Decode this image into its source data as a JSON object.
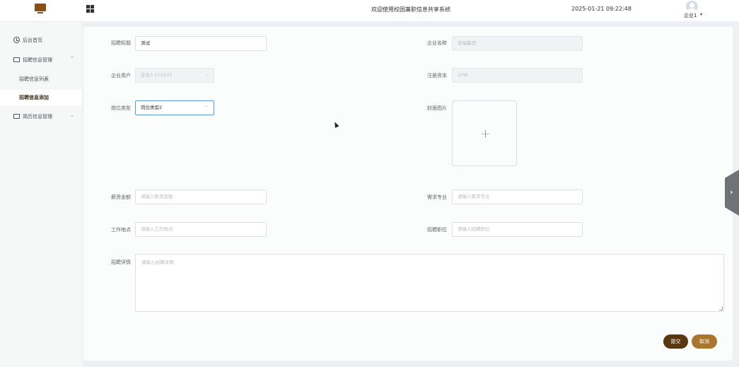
{
  "header": {
    "title": "欢迎使用校园兼职信息共享系统",
    "datetime": "2025-01-21 09:22:48",
    "user": "企业1",
    "user_caret": "▾",
    "logo_icon": "monitor-icon",
    "apps_icon": "grid-icon"
  },
  "sidebar": {
    "items": [
      {
        "label": "后台首页",
        "icon": "clock-icon"
      },
      {
        "label": "招聘信息管理",
        "icon": "box-icon",
        "expanded": true,
        "chevron": "^"
      },
      {
        "label": "招聘信息列表"
      },
      {
        "label": "招聘信息添加",
        "active": true
      },
      {
        "label": "简历信息管理",
        "icon": "box-icon",
        "expanded": false,
        "chevron": "⌄"
      }
    ]
  },
  "form": {
    "title_label": "招聘标题",
    "title_value": "测试",
    "company_label": "企业名称",
    "company_value": "幸福集团",
    "account_label": "企业用户",
    "account_value": "企业1-112233",
    "capital_label": "注册资本",
    "capital_value": "20W",
    "jobtype_label": "岗位类型",
    "jobtype_value": "岗位类型2",
    "cover_label": "封面图片",
    "cover_plus": "+",
    "salary_label": "薪资金额",
    "salary_placeholder": "请输入薪资金额",
    "major_label": "需求专业",
    "major_placeholder": "请输入需求专业",
    "location_label": "工作地点",
    "location_placeholder": "请输入工作地点",
    "position_label": "招聘职位",
    "position_placeholder": "请输入招聘职位",
    "detail_label": "招聘详情",
    "detail_placeholder": "请输入招聘详情"
  },
  "buttons": {
    "submit": "提交",
    "cancel": "取消"
  },
  "side_tab_arrow": "›",
  "colors": {
    "brand": "#8a4f14",
    "submit": "#5a3612",
    "cancel": "#a8762c"
  }
}
